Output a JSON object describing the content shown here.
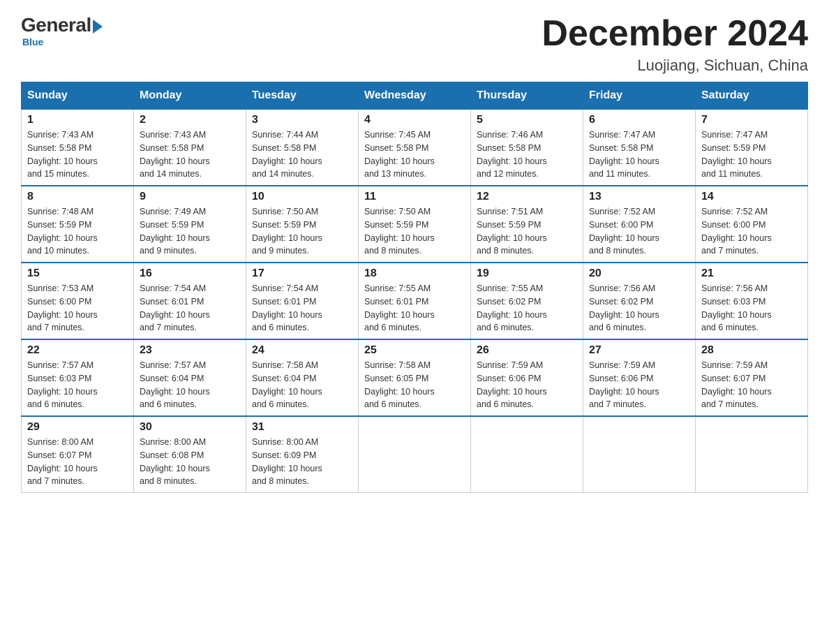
{
  "logo": {
    "general": "General",
    "blue": "Blue",
    "subtitle": "Blue"
  },
  "title": {
    "month_year": "December 2024",
    "location": "Luojiang, Sichuan, China"
  },
  "days_header": [
    "Sunday",
    "Monday",
    "Tuesday",
    "Wednesday",
    "Thursday",
    "Friday",
    "Saturday"
  ],
  "weeks": [
    [
      {
        "day": "1",
        "sunrise": "7:43 AM",
        "sunset": "5:58 PM",
        "daylight": "10 hours and 15 minutes."
      },
      {
        "day": "2",
        "sunrise": "7:43 AM",
        "sunset": "5:58 PM",
        "daylight": "10 hours and 14 minutes."
      },
      {
        "day": "3",
        "sunrise": "7:44 AM",
        "sunset": "5:58 PM",
        "daylight": "10 hours and 14 minutes."
      },
      {
        "day": "4",
        "sunrise": "7:45 AM",
        "sunset": "5:58 PM",
        "daylight": "10 hours and 13 minutes."
      },
      {
        "day": "5",
        "sunrise": "7:46 AM",
        "sunset": "5:58 PM",
        "daylight": "10 hours and 12 minutes."
      },
      {
        "day": "6",
        "sunrise": "7:47 AM",
        "sunset": "5:58 PM",
        "daylight": "10 hours and 11 minutes."
      },
      {
        "day": "7",
        "sunrise": "7:47 AM",
        "sunset": "5:59 PM",
        "daylight": "10 hours and 11 minutes."
      }
    ],
    [
      {
        "day": "8",
        "sunrise": "7:48 AM",
        "sunset": "5:59 PM",
        "daylight": "10 hours and 10 minutes."
      },
      {
        "day": "9",
        "sunrise": "7:49 AM",
        "sunset": "5:59 PM",
        "daylight": "10 hours and 9 minutes."
      },
      {
        "day": "10",
        "sunrise": "7:50 AM",
        "sunset": "5:59 PM",
        "daylight": "10 hours and 9 minutes."
      },
      {
        "day": "11",
        "sunrise": "7:50 AM",
        "sunset": "5:59 PM",
        "daylight": "10 hours and 8 minutes."
      },
      {
        "day": "12",
        "sunrise": "7:51 AM",
        "sunset": "5:59 PM",
        "daylight": "10 hours and 8 minutes."
      },
      {
        "day": "13",
        "sunrise": "7:52 AM",
        "sunset": "6:00 PM",
        "daylight": "10 hours and 8 minutes."
      },
      {
        "day": "14",
        "sunrise": "7:52 AM",
        "sunset": "6:00 PM",
        "daylight": "10 hours and 7 minutes."
      }
    ],
    [
      {
        "day": "15",
        "sunrise": "7:53 AM",
        "sunset": "6:00 PM",
        "daylight": "10 hours and 7 minutes."
      },
      {
        "day": "16",
        "sunrise": "7:54 AM",
        "sunset": "6:01 PM",
        "daylight": "10 hours and 7 minutes."
      },
      {
        "day": "17",
        "sunrise": "7:54 AM",
        "sunset": "6:01 PM",
        "daylight": "10 hours and 6 minutes."
      },
      {
        "day": "18",
        "sunrise": "7:55 AM",
        "sunset": "6:01 PM",
        "daylight": "10 hours and 6 minutes."
      },
      {
        "day": "19",
        "sunrise": "7:55 AM",
        "sunset": "6:02 PM",
        "daylight": "10 hours and 6 minutes."
      },
      {
        "day": "20",
        "sunrise": "7:56 AM",
        "sunset": "6:02 PM",
        "daylight": "10 hours and 6 minutes."
      },
      {
        "day": "21",
        "sunrise": "7:56 AM",
        "sunset": "6:03 PM",
        "daylight": "10 hours and 6 minutes."
      }
    ],
    [
      {
        "day": "22",
        "sunrise": "7:57 AM",
        "sunset": "6:03 PM",
        "daylight": "10 hours and 6 minutes."
      },
      {
        "day": "23",
        "sunrise": "7:57 AM",
        "sunset": "6:04 PM",
        "daylight": "10 hours and 6 minutes."
      },
      {
        "day": "24",
        "sunrise": "7:58 AM",
        "sunset": "6:04 PM",
        "daylight": "10 hours and 6 minutes."
      },
      {
        "day": "25",
        "sunrise": "7:58 AM",
        "sunset": "6:05 PM",
        "daylight": "10 hours and 6 minutes."
      },
      {
        "day": "26",
        "sunrise": "7:59 AM",
        "sunset": "6:06 PM",
        "daylight": "10 hours and 6 minutes."
      },
      {
        "day": "27",
        "sunrise": "7:59 AM",
        "sunset": "6:06 PM",
        "daylight": "10 hours and 7 minutes."
      },
      {
        "day": "28",
        "sunrise": "7:59 AM",
        "sunset": "6:07 PM",
        "daylight": "10 hours and 7 minutes."
      }
    ],
    [
      {
        "day": "29",
        "sunrise": "8:00 AM",
        "sunset": "6:07 PM",
        "daylight": "10 hours and 7 minutes."
      },
      {
        "day": "30",
        "sunrise": "8:00 AM",
        "sunset": "6:08 PM",
        "daylight": "10 hours and 8 minutes."
      },
      {
        "day": "31",
        "sunrise": "8:00 AM",
        "sunset": "6:09 PM",
        "daylight": "10 hours and 8 minutes."
      },
      null,
      null,
      null,
      null
    ]
  ],
  "labels": {
    "sunrise": "Sunrise:",
    "sunset": "Sunset:",
    "daylight": "Daylight:"
  }
}
